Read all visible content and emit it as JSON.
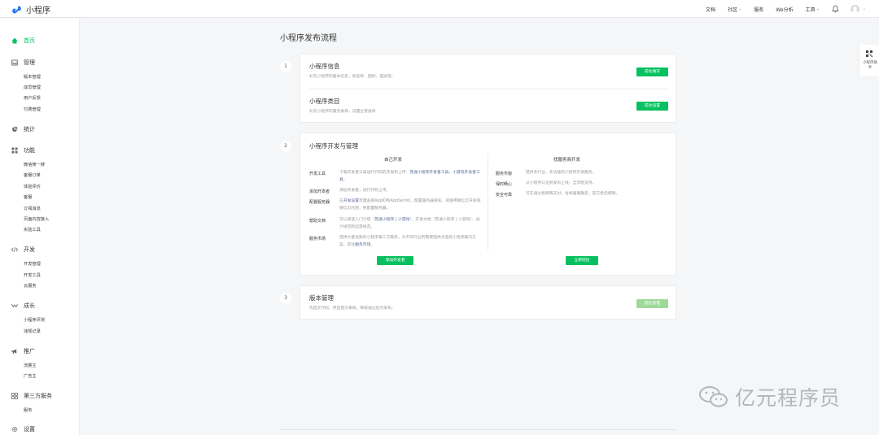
{
  "app": {
    "title": "小程序"
  },
  "topnav": {
    "docs": "文档",
    "community": "社区",
    "service": "服务",
    "we_analysis": "We分析",
    "tools": "工具"
  },
  "sidebar": {
    "home": "首页",
    "manage": {
      "label": "管理",
      "items": [
        "版本管理",
        "成员管理",
        "用户反馈",
        "付费管理"
      ]
    },
    "stats": "统计",
    "features": {
      "label": "功能",
      "items": [
        "微信搜一搜",
        "客服订单",
        "体验评价",
        "客服",
        "订阅消息",
        "页面内容接入",
        "实验工具"
      ]
    },
    "develop": {
      "label": "开发",
      "items": [
        "开发管理",
        "开发工具",
        "云服务"
      ]
    },
    "growth": {
      "label": "成长",
      "items": [
        "小程序评测",
        "违规记录"
      ]
    },
    "promote": {
      "label": "推广",
      "items": [
        "流量主",
        "广告主"
      ]
    },
    "third_party": {
      "label": "第三方服务",
      "items": [
        "服务"
      ]
    },
    "settings": "设置"
  },
  "page": {
    "title": "小程序发布流程"
  },
  "steps": {
    "s1": {
      "num": "1",
      "info_title": "小程序信息",
      "info_desc": "补充小程序的基本信息，如名称、图标、描述等。",
      "info_button": "前往填写",
      "cat_title": "小程序类目",
      "cat_desc": "补充小程序的服务类目，设置主营类目",
      "cat_button": "前往设置"
    },
    "s2": {
      "num": "2",
      "title": "小程序开发与管理",
      "self_dev": "自己开发",
      "provider_dev": "找服务商开发",
      "rows_left": [
        {
          "label": "开发工具",
          "pre": "下载开发者工具进行代码的开发和上传：",
          "link": "普通小程序开发者工具、小游戏开发者工具",
          "post": "。"
        },
        {
          "label": "添加开发者",
          "pre": "添加开发者，进行代码上传。",
          "link": "",
          "post": ""
        },
        {
          "label": "配置服务器",
          "pre": "在",
          "link": "开发设置",
          "post": "页面查看AppID和AppSecret，配置服务器域名。或使用微信云开发或微信云托管，免配置服务器。"
        },
        {
          "label": "帮助文档",
          "pre": "可以阅读入门介绍（",
          "link": "普通小程序 | 小游戏",
          "post": "）、开发文档（普通小程序 | 小游戏）、设计规范和运营规范。"
        },
        {
          "label": "服务市场",
          "pre": "提供大量优质的小程序第三方服务，为不同行业的需要提供点选的小程序解决方案。前往",
          "link": "服务市场",
          "post": "。"
        }
      ],
      "rows_right": [
        {
          "label": "服务市窗",
          "text": "提供多行业、多功能的小程序开发服务。"
        },
        {
          "label": "保时畅心",
          "text": "从小程序认证到发布上线，全流程支持。"
        },
        {
          "label": "安全可靠",
          "text": "可先通过担保再支付，合规着重确定，官方售后保障。"
        }
      ],
      "left_button": "添加开发者",
      "right_button": "立即前往"
    },
    "s3": {
      "num": "3",
      "title": "版本管理",
      "desc": "先提交代码，然后提交审核，审核通过后可发布。",
      "button": "前往管理"
    }
  },
  "float_panel": {
    "label": "小程序助手"
  },
  "watermark": {
    "text": "亿元程序员"
  },
  "colors": {
    "accent": "#07c160",
    "link": "#576b95",
    "muted": "#999999"
  }
}
